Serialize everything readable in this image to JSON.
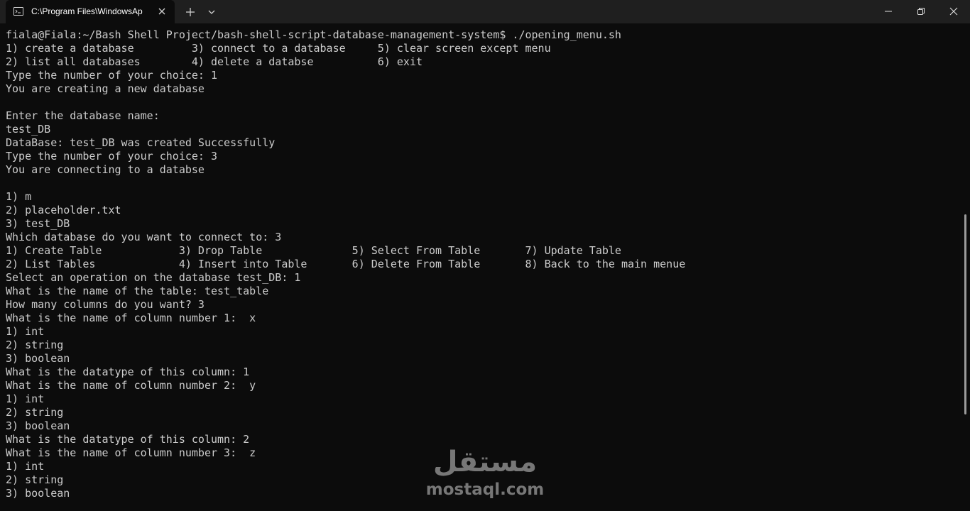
{
  "window": {
    "tab_title": "C:\\Program Files\\WindowsAp"
  },
  "terminal": {
    "lines": [
      "fiala@Fiala:~/Bash Shell Project/bash-shell-script-database-management-system$ ./opening_menu.sh",
      "1) create a database         3) connect to a database     5) clear screen except menu",
      "2) list all databases        4) delete a databse          6) exit",
      "Type the number of your choice: 1",
      "You are creating a new database",
      "",
      "Enter the database name:",
      "test_DB",
      "DataBase: test_DB was created Successfully",
      "Type the number of your choice: 3",
      "You are connecting to a databse",
      "",
      "1) m",
      "2) placeholder.txt",
      "3) test_DB",
      "Which database do you want to connect to: 3",
      "1) Create Table            3) Drop Table              5) Select From Table       7) Update Table",
      "2) List Tables             4) Insert into Table       6) Delete From Table       8) Back to the main menue",
      "Select an operation on the database test_DB: 1",
      "What is the name of the table: test_table",
      "How many columns do you want? 3",
      "What is the name of column number 1:  x",
      "1) int",
      "2) string",
      "3) boolean",
      "What is the datatype of this column: 1",
      "What is the name of column number 2:  y",
      "1) int",
      "2) string",
      "3) boolean",
      "What is the datatype of this column: 2",
      "What is the name of column number 3:  z",
      "1) int",
      "2) string",
      "3) boolean"
    ]
  },
  "watermark": {
    "arabic": "مستقل",
    "latin": "mostaql.com"
  },
  "icons": {
    "tab": "terminal-icon",
    "close_tab": "close-icon",
    "new_tab": "plus-icon",
    "dropdown": "chevron-down-icon",
    "minimize": "minimize-icon",
    "maximize": "restore-icon",
    "close_window": "close-icon"
  },
  "colors": {
    "background": "#0c0c0c",
    "titlebar": "#1f1f1f",
    "text": "#cccccc"
  }
}
